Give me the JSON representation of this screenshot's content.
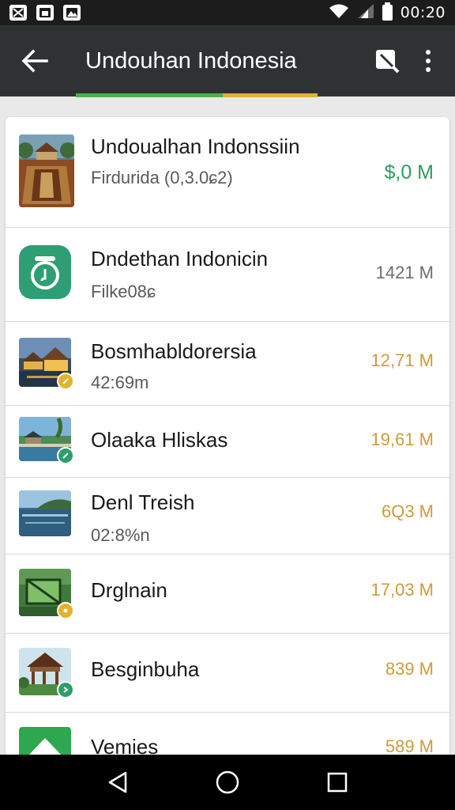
{
  "status_bar": {
    "time": "00:20",
    "icons": [
      "image-icon",
      "gallery-icon",
      "picture-icon",
      "wifi-icon",
      "signal-icon",
      "battery-icon"
    ]
  },
  "app_bar": {
    "title": "Undouhan Indonesia",
    "back_icon": "back-arrow-icon",
    "search_icon": "search-icon",
    "menu_icon": "more-vert-icon",
    "progress_colors": [
      "#4caf50",
      "#e0b231"
    ]
  },
  "items": [
    {
      "title": "Undoualhan Indonssiin",
      "subtitle": "Firdurida (0,3.0ɕ2)",
      "size": "$,0 M",
      "size_color": "#2e9e5e",
      "thumb": "temple-pavilion",
      "badge": "none"
    },
    {
      "title": "Dndethan Indonicin",
      "subtitle": "Filke08ɕ",
      "size": "1421 M",
      "size_color": "#6e6e6e",
      "thumb": "green-app-icon",
      "badge": "none"
    },
    {
      "title": "Bosmhabldorersia",
      "subtitle": "42:69m",
      "size": "12,71 M",
      "size_color": "#d09a3a",
      "thumb": "resort-pavilion",
      "badge": "yellow"
    },
    {
      "title": "Olaaka Hliskas",
      "subtitle": "",
      "size": "19,61 M",
      "size_color": "#d09a3a",
      "thumb": "beach-hut",
      "badge": "green"
    },
    {
      "title": "Denl Treish",
      "subtitle": "02:8%n",
      "size": "6Q3 M",
      "size_color": "#d09a3a",
      "thumb": "lake-hill",
      "badge": "none"
    },
    {
      "title": "Drglnain",
      "subtitle": "",
      "size": "17,03 M",
      "size_color": "#d09a3a",
      "thumb": "garden-frame",
      "badge": "yellow"
    },
    {
      "title": "Besginbuha",
      "subtitle": "",
      "size": "839 M",
      "size_color": "#d09a3a",
      "thumb": "gazebo",
      "badge": "green"
    },
    {
      "title": "Vemies",
      "subtitle": "",
      "size": "589 M",
      "size_color": "#d09a3a",
      "thumb": "green-tent",
      "badge": "none"
    }
  ],
  "nav_bar": {
    "icons": [
      "nav-back-icon",
      "nav-home-icon",
      "nav-recents-icon"
    ]
  }
}
